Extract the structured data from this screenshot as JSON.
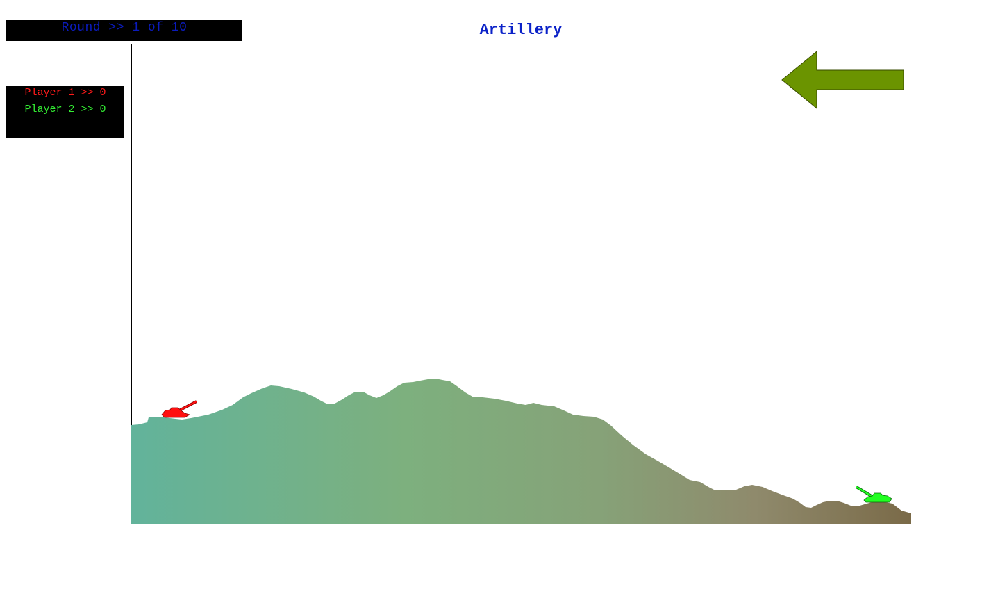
{
  "game": {
    "title": "Artillery",
    "round_label": "Round >> 1 of 10",
    "round": {
      "current": 1,
      "total": 10
    }
  },
  "scoreboard": {
    "players": [
      {
        "label": "Player 1 >> 0",
        "name": "Player 1",
        "score": 0,
        "color": "#ff1a1a"
      },
      {
        "label": "Player 2 >> 0",
        "name": "Player 2",
        "score": 0,
        "color": "#33ee33"
      }
    ]
  },
  "wind": {
    "direction": "left",
    "color": "#6b9400",
    "icon": "left-arrow-icon"
  },
  "terrain": {
    "gradient_start": "#62b39b",
    "gradient_mid": "#80ab78",
    "gradient_end": "#7a6a48"
  },
  "tanks": [
    {
      "player": "Player 1",
      "color": "#ff1010",
      "facing": "right"
    },
    {
      "player": "Player 2",
      "color": "#22ff22",
      "facing": "left"
    }
  ]
}
